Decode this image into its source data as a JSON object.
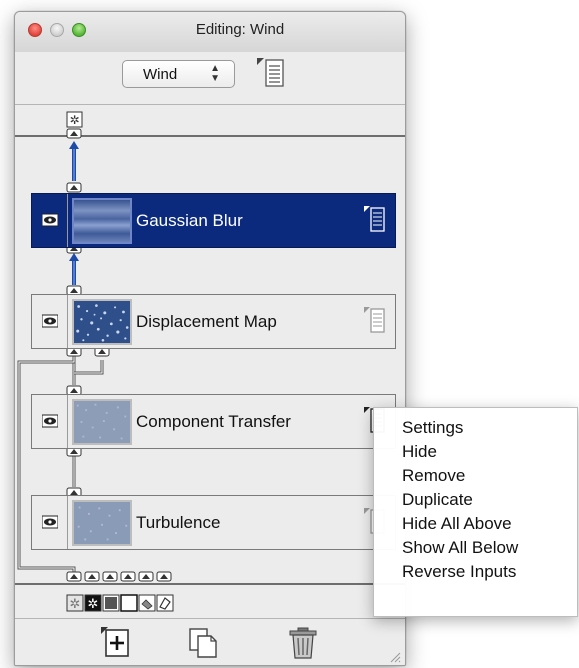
{
  "window": {
    "title": "Editing: Wind"
  },
  "filter_selector": {
    "selected": "Wind"
  },
  "layers": [
    {
      "name": "Gaussian Blur",
      "selected": true,
      "visible": true,
      "thumbnail": "horizontal-streaks"
    },
    {
      "name": "Displacement Map",
      "selected": false,
      "visible": true,
      "thumbnail": "noise-speckle"
    },
    {
      "name": "Component Transfer",
      "selected": false,
      "visible": true,
      "thumbnail": "grey-noise"
    },
    {
      "name": "Turbulence",
      "selected": false,
      "visible": true,
      "thumbnail": "grey-noise"
    }
  ],
  "input_sources": [
    "source-graphic-icon",
    "source-alpha-icon",
    "background-image-icon",
    "background-alpha-icon",
    "fill-paint-icon",
    "stroke-paint-icon"
  ],
  "bottom_toolbar": [
    "add-icon",
    "duplicate-icon",
    "trash-icon"
  ],
  "context_menu": {
    "items": [
      "Settings",
      "Hide",
      "Remove",
      "Duplicate",
      "Hide All Above",
      "Show All Below",
      "Reverse Inputs"
    ]
  },
  "colors": {
    "selection": "#0b2a7e",
    "connector": "#1d4aa8",
    "window_bg": "#ececec"
  }
}
